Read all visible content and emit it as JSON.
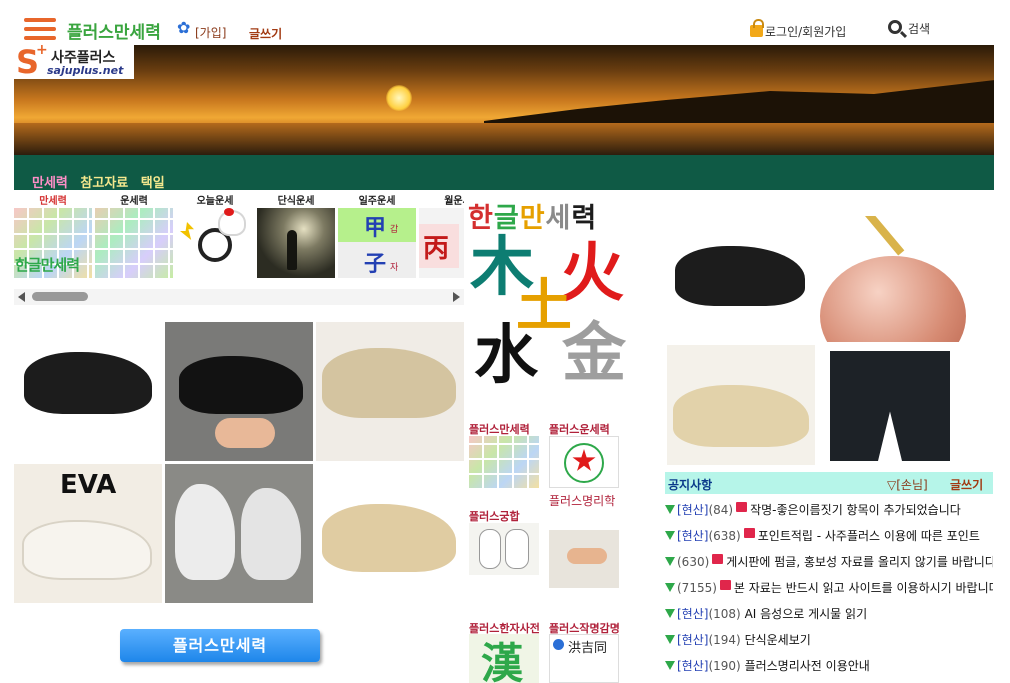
{
  "header": {
    "site_title": "플러스만세력",
    "join_label": "[가입]",
    "write_label": "글쓰기",
    "login_label": "로그인/회원가입",
    "search_label": "검색"
  },
  "logo": {
    "mark": "S",
    "plus": "+",
    "name_kr": "사주플러스",
    "name_en": "sajuplus.net"
  },
  "nav": {
    "items": [
      {
        "label": "만세력",
        "color": "#ff8fc8"
      },
      {
        "label": "참고자료",
        "color": "#f4e88e"
      },
      {
        "label": "택일",
        "color": "#f4e88e"
      }
    ]
  },
  "thumbs": [
    {
      "label": "만세력",
      "color": "#d42f2f"
    },
    {
      "label": "운세력",
      "color": "#222222"
    },
    {
      "label": "오늘운세",
      "color": "#222222"
    },
    {
      "label": "단식운세",
      "color": "#222222"
    },
    {
      "label": "일주운세",
      "color": "#222222"
    },
    {
      "label": "월운세",
      "color": "#222222"
    }
  ],
  "thumb_text": {
    "hangul": "한글만세력",
    "gap": "甲",
    "gap_sub": "갑",
    "ja": "子",
    "ja_sub": "자",
    "byeong": "丙"
  },
  "products_overlay": {
    "eva": "EVA"
  },
  "big_button": "플러스만세력",
  "middle": {
    "hangul_title": [
      "한",
      "글",
      "만",
      "세",
      "력"
    ],
    "hangul_colors": [
      "#d42f2f",
      "#2ea84a",
      "#e6a000",
      "#7a7a7a",
      "#1c1c1c"
    ],
    "ohaeng": [
      {
        "char": "木",
        "color": "#0d7d72"
      },
      {
        "char": "火",
        "color": "#e01b1b"
      },
      {
        "char": "土",
        "color": "#e6a000"
      },
      {
        "char": "水",
        "color": "#111111"
      },
      {
        "char": "金",
        "color": "#9e9e9e"
      }
    ],
    "labels": [
      "플러스만세력",
      "플러스운세력",
      "플러스궁합",
      "플러스명리학",
      "플러스한자사전",
      "플러스작명감명"
    ],
    "hanja_sample": "漢",
    "name_sample": "洪吉同"
  },
  "notice": {
    "title": "공지사항",
    "guest": "▽[손님]",
    "write": "글쓰기",
    "rows": [
      {
        "cat": "[현산]",
        "count": "(84)",
        "memo": true,
        "title": "작명-좋은이름짓기 항목이 추가되었습니다"
      },
      {
        "cat": "[현산]",
        "count": "(638)",
        "memo": true,
        "title": "포인트적립 - 사주플러스 이용에 따른 포인트"
      },
      {
        "cat": "",
        "count": "(630)",
        "memo": true,
        "title": "게시판에 펌글, 홍보성 자료를 올리지 않기를 바랍니다"
      },
      {
        "cat": "",
        "count": "(7155)",
        "memo": true,
        "title": "본 자료는 반드시 읽고 사이트를 이용하시기 바랍니다"
      },
      {
        "cat": "[현산]",
        "count": "(108)",
        "memo": false,
        "title": "AI 음성으로 게시물 읽기"
      },
      {
        "cat": "[현산]",
        "count": "(194)",
        "memo": false,
        "title": "단식운세보기"
      },
      {
        "cat": "[현산]",
        "count": "(190)",
        "memo": false,
        "title": "플러스명리사전 이용안내"
      }
    ]
  }
}
